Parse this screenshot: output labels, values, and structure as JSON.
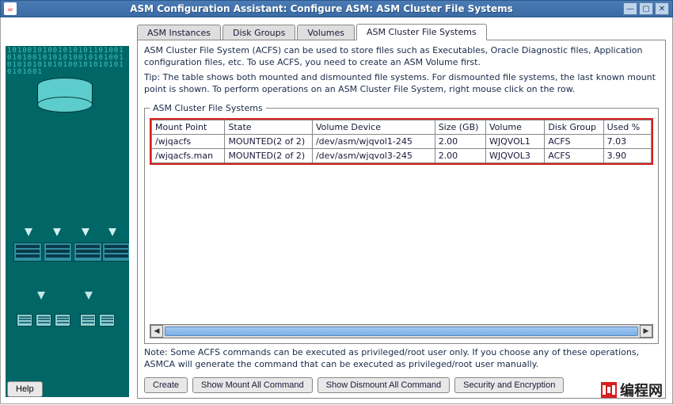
{
  "window": {
    "title": "ASM Configuration Assistant: Configure ASM: ASM Cluster File Systems"
  },
  "tabs": [
    {
      "label": "ASM Instances"
    },
    {
      "label": "Disk Groups"
    },
    {
      "label": "Volumes"
    },
    {
      "label": "ASM Cluster File Systems"
    }
  ],
  "active_tab_index": 3,
  "description": "ASM Cluster File System (ACFS) can be used to store files such as Executables, Oracle Diagnostic files, Application configuration files, etc. To use ACFS, you need to create an ASM Volume first.",
  "tip": "Tip: The table shows both mounted and dismounted file systems. For dismounted file systems, the last known mount point is shown. To perform operations on an ASM Cluster File System, right mouse click on the row.",
  "fieldset_legend": "ASM Cluster File Systems",
  "table": {
    "headers": [
      "Mount Point",
      "State",
      "Volume Device",
      "Size (GB)",
      "Volume",
      "Disk Group",
      "Used %"
    ],
    "rows": [
      {
        "mount_point": "/wjqacfs",
        "state": "MOUNTED(2 of 2)",
        "volume_device": "/dev/asm/wjqvol1-245",
        "size_gb": "2.00",
        "volume": "WJQVOL1",
        "disk_group": "ACFS",
        "used_pct": "7.03"
      },
      {
        "mount_point": "/wjqacfs.man",
        "state": "MOUNTED(2 of 2)",
        "volume_device": "/dev/asm/wjqvol3-245",
        "size_gb": "2.00",
        "volume": "WJQVOL3",
        "disk_group": "ACFS",
        "used_pct": "3.90"
      }
    ]
  },
  "note": "Note: Some ACFS commands can be executed as privileged/root user only. If you choose any of these operations, ASMCA will generate the command that can be executed as privileged/root user manually.",
  "buttons": {
    "create": "Create",
    "show_mount_all": "Show Mount All Command",
    "show_dismount_all": "Show Dismount All Command",
    "security_encryption": "Security and Encryption",
    "help": "Help"
  },
  "watermark": "编程网",
  "colors": {
    "highlight_border": "#d61f1f",
    "titlebar": "#3a6ba5"
  }
}
